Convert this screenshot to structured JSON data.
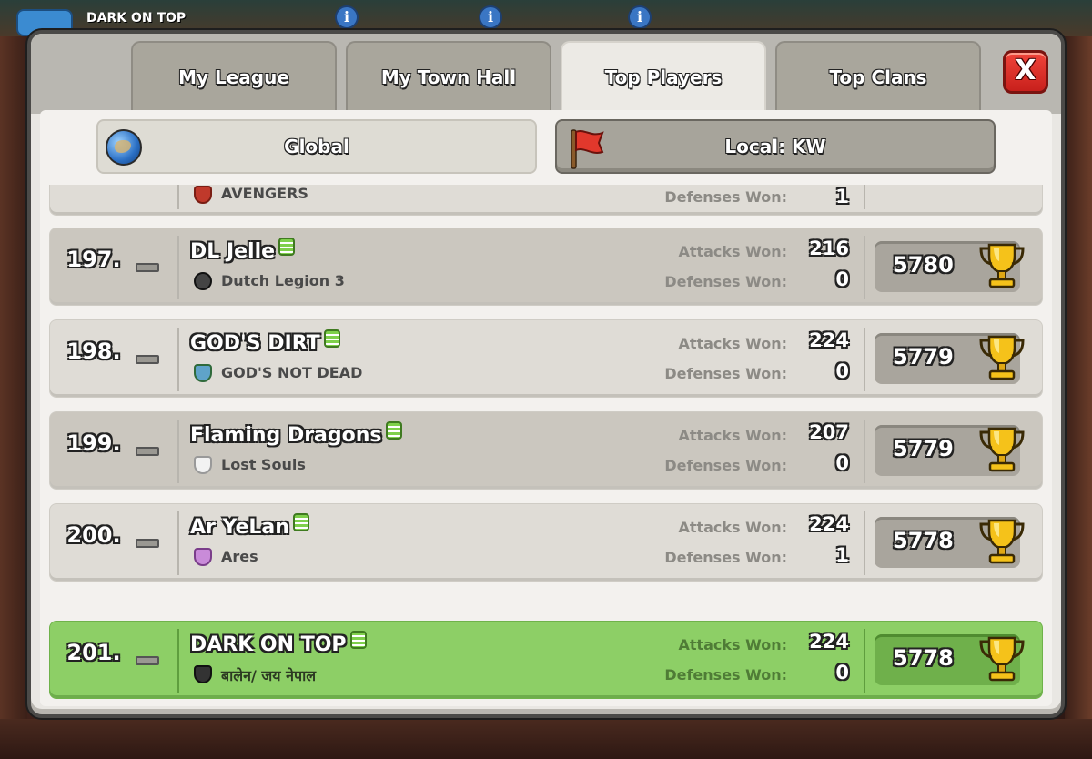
{
  "background": {
    "village_label": "DARK ON TOP"
  },
  "tabs": [
    {
      "label": "My League",
      "active": false
    },
    {
      "label": "My Town Hall",
      "active": false
    },
    {
      "label": "Top Players",
      "active": true
    },
    {
      "label": "Top Clans",
      "active": false
    }
  ],
  "close_label": "X",
  "filters": {
    "global_label": "Global",
    "local_label": "Local: KW",
    "selected": "local"
  },
  "stats_labels": {
    "attacks": "Attacks Won:",
    "defenses": "Defenses Won:"
  },
  "partial_row": {
    "clan": "AVENGERS",
    "defenses_won": "1"
  },
  "rows": [
    {
      "rank": "197.",
      "name": "DL Jelle",
      "clan": "Dutch Legion 3",
      "attacks_won": "216",
      "defenses_won": "0",
      "trophies": "5780"
    },
    {
      "rank": "198.",
      "name": "GOD'S DIRT",
      "clan": "GOD'S NOT DEAD",
      "attacks_won": "224",
      "defenses_won": "0",
      "trophies": "5779"
    },
    {
      "rank": "199.",
      "name": "Flaming Dragons",
      "clan": "Lost Souls",
      "attacks_won": "207",
      "defenses_won": "0",
      "trophies": "5779"
    },
    {
      "rank": "200.",
      "name": "Ar YeLan",
      "clan": "Ares",
      "attacks_won": "224",
      "defenses_won": "1",
      "trophies": "5778"
    }
  ],
  "my_row": {
    "rank": "201.",
    "name": "DARK ON TOP",
    "clan": "बालेन/ जय नेपाल",
    "attacks_won": "224",
    "defenses_won": "0",
    "trophies": "5778"
  },
  "colors": {
    "my_row": "#8dcf66",
    "close_button": "#e0332b",
    "panel": "#e9e7e3"
  }
}
